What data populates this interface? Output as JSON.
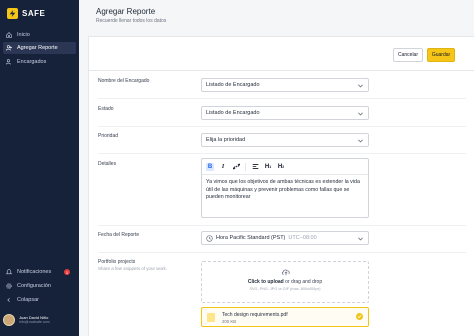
{
  "app": {
    "brand": "SAFE"
  },
  "sidebar": {
    "items": [
      {
        "label": "Inicio",
        "icon": "home-icon"
      },
      {
        "label": "Agregar Reporte",
        "icon": "user-add-icon"
      },
      {
        "label": "Encargados",
        "icon": "users-icon"
      }
    ],
    "bottom": [
      {
        "label": "Notificaciones",
        "icon": "bell-icon",
        "badge": "1"
      },
      {
        "label": "Configuración",
        "icon": "gear-icon"
      },
      {
        "label": "Colapsar",
        "icon": "collapse-icon"
      }
    ],
    "user": {
      "name": "Juan David Niño",
      "email": "info@ovalsafe.com"
    }
  },
  "header": {
    "title": "Agregar Reporte",
    "subtitle": "Recuerde llenar todos los datos"
  },
  "actions": {
    "cancel": "Cancelar",
    "save": "Guardar"
  },
  "form": {
    "encargado": {
      "label": "Nombre del Encargado",
      "value": "Listado de Encargado"
    },
    "estado": {
      "label": "Estado",
      "value": "Listado de Encargado"
    },
    "prioridad": {
      "label": "Prioridad",
      "value": "Elija la prioridad"
    },
    "detalles": {
      "label": "Detalles",
      "text": "Ya vimos que los objetivos de ambas técnicas es extender la vida útil de las máquinas y prevenir problemas como fallas que se pueden monitorear"
    },
    "fecha": {
      "label": "Fecha del Reporte",
      "value": "Hora Pacific Standard (PST)",
      "offset": "UTC−08:00"
    },
    "portfolio": {
      "label": "Portfolio projects",
      "sublabel": "Share a few snippets of your work.",
      "upload_bold": "Click to upload",
      "upload_rest": " or drag and drop",
      "upload_types": "SVG, PNG, JPG or GIF (max. 800x400px)"
    },
    "file": {
      "name": "Tech design requirements.pdf",
      "size": "200 KB"
    }
  },
  "colors": {
    "sidebar": "#16213a",
    "accent": "#f5c518",
    "badge": "#e53e3e"
  }
}
